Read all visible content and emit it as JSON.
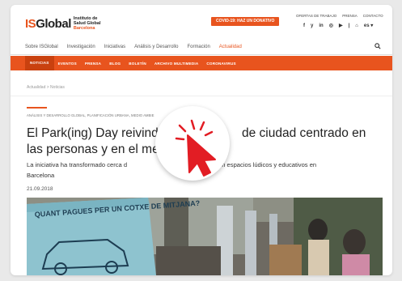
{
  "header": {
    "logo": {
      "brand_is": "IS",
      "brand_global": "Global",
      "sub_line1": "Instituto de",
      "sub_line2": "Salud Global",
      "sub_line3": "Barcelona"
    },
    "donate_label": "COVID-19: HAZ UN DONATIVO",
    "toplinks": [
      "OFERTAS DE TRABAJO",
      "PRENSA",
      "CONTACTO"
    ],
    "social": [
      "f",
      "y",
      "in",
      "◎",
      "▶",
      "|",
      "⌂",
      "es ▾"
    ]
  },
  "nav": {
    "items": [
      "Sobre ISGlobal",
      "Investigación",
      "Iniciativas",
      "Análisis y Desarrollo",
      "Formación",
      "Actualidad"
    ],
    "active_index": 5
  },
  "subnav": {
    "items": [
      "NOTICIAS",
      "EVENTOS",
      "PRENSA",
      "BLOG",
      "BOLETÍN",
      "ARCHIVO MULTIMEDIA",
      "CORONAVIRUS"
    ],
    "active_index": 0
  },
  "breadcrumb": "Actualidad > Noticias",
  "article": {
    "category": "ANÁLISIS Y DESARROLLO GLOBAL, PLANIFICACIÓN URBANA, MEDIO AMBIE",
    "headline_part1": "El Park(ing) Day reivindic",
    "headline_part2": "de ciudad centrado en",
    "headline_line2": "las personas y en el me",
    "lede_part1": "La iniciativa ha transformado cerca d",
    "lede_part2": "ento en espacios lúdicos y educativos en",
    "lede_line2": "Barcelona",
    "date": "21.09.2018",
    "photo_sign_text": "QUANT PAGUES PER UN COTXE DE MITJANA?"
  },
  "colors": {
    "accent": "#e8541e",
    "cursor_red": "#e21d24"
  },
  "icons": {
    "search": "search-icon",
    "cursor": "pointer-hand-icon"
  }
}
